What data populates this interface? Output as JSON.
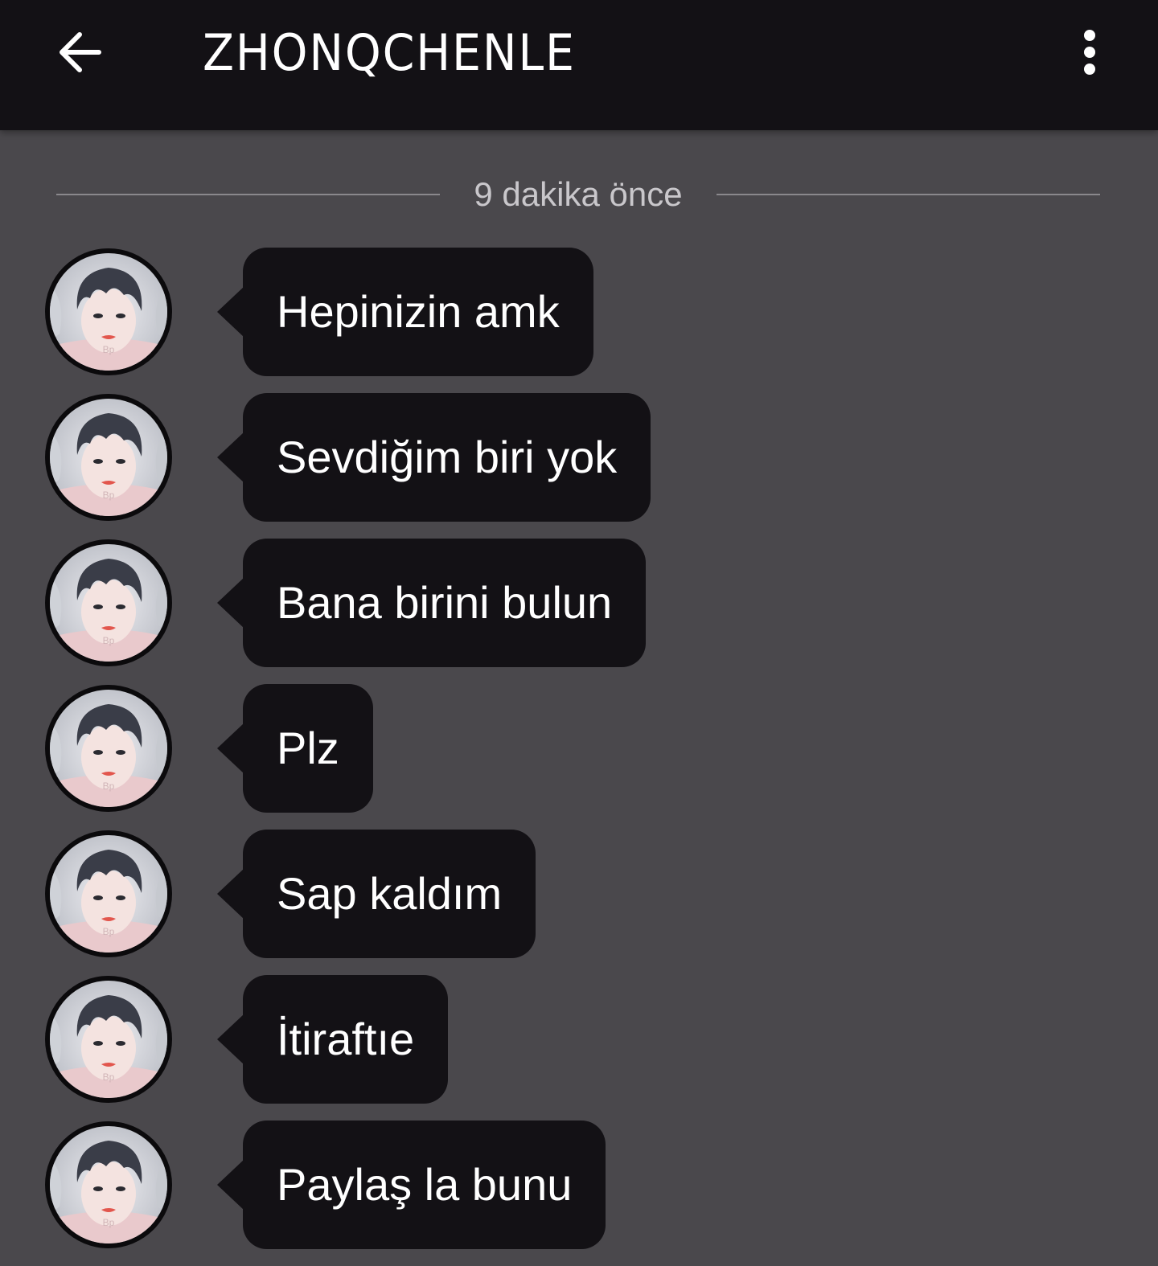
{
  "header": {
    "title": "ZHONQCHENLE",
    "back_icon": "arrow-left-icon",
    "menu_icon": "more-vertical-icon"
  },
  "divider": {
    "timestamp": "9 dakika önce"
  },
  "messages": [
    {
      "text": "Hepinizin amk"
    },
    {
      "text": "Sevdiğim biri yok"
    },
    {
      "text": "Bana birini bulun"
    },
    {
      "text": "Plz"
    },
    {
      "text": "Sap kaldım"
    },
    {
      "text": "İtiraftıe"
    },
    {
      "text": "Paylaş la bunu"
    }
  ],
  "colors": {
    "background": "#4a484c",
    "topbar": "#131115",
    "bubble": "#131115",
    "text": "#ffffff",
    "timestamp": "#c9c7cb"
  }
}
